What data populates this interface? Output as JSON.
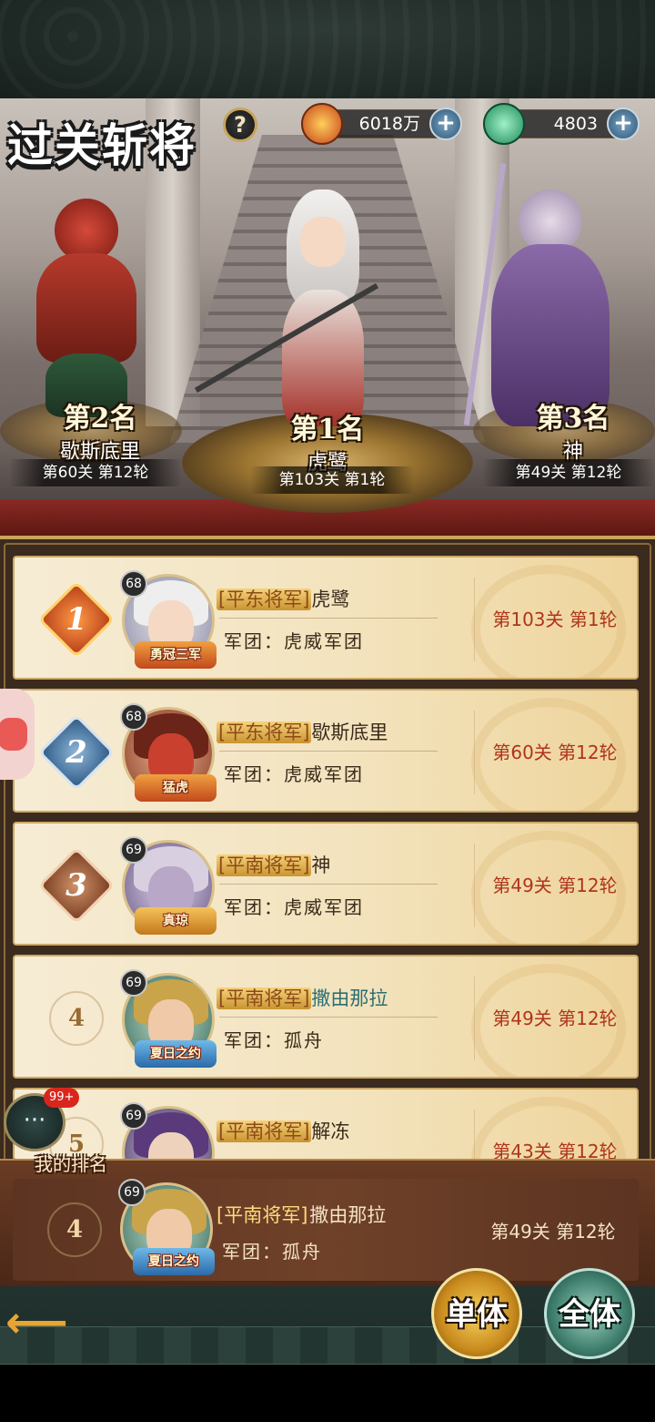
{
  "header": {
    "title": "过关斩将",
    "help_icon": "question-icon",
    "currencies": [
      {
        "icon": "gold-coin-icon",
        "value": "6018万",
        "add_icon": "plus-icon"
      },
      {
        "icon": "jade-icon",
        "value": "4803",
        "add_icon": "plus-icon"
      }
    ]
  },
  "podium": [
    {
      "rank_label": "第2名",
      "name": "歇斯底里",
      "progress": "第60关 第12轮"
    },
    {
      "rank_label": "第1名",
      "name": "虎鹭",
      "progress": "第103关 第1轮"
    },
    {
      "rank_label": "第3名",
      "name": "神",
      "progress": "第49关 第12轮"
    }
  ],
  "ranking": [
    {
      "rank": "1",
      "level": "68",
      "tag": "勇冠三军",
      "title": "[平东将军]",
      "name": "虎鹭",
      "legion": "军团：虎威军团",
      "progress": "第103关 第1轮"
    },
    {
      "rank": "2",
      "level": "68",
      "tag": "猛虎",
      "title": "[平东将军]",
      "name": "歇斯底里",
      "legion": "军团：虎威军团",
      "progress": "第60关 第12轮"
    },
    {
      "rank": "3",
      "level": "69",
      "tag": "真琼",
      "title": "[平南将军]",
      "name": "神",
      "legion": "军团：虎威军团",
      "progress": "第49关 第12轮"
    },
    {
      "rank": "4",
      "level": "69",
      "tag": "夏日之约",
      "title": "[平南将军]",
      "name": "撒由那拉",
      "legion": "军团：孤舟",
      "progress": "第49关 第12轮"
    },
    {
      "rank": "5",
      "level": "69",
      "tag": "",
      "title": "[平南将军]",
      "name": "解冻",
      "legion": "",
      "progress": "第43关 第12轮"
    }
  ],
  "chat": {
    "badge": "99+",
    "icon": "chat-bubble-icon"
  },
  "my_rank": {
    "label": "我的排名",
    "rank": "4",
    "level": "69",
    "tag": "夏日之约",
    "title": "[平南将军]",
    "name": "撒由那拉",
    "legion": "军团：孤舟",
    "progress": "第49关 第12轮"
  },
  "footer": {
    "back_icon": "back-arrow-icon",
    "single_label": "单体",
    "all_label": "全体"
  },
  "colors": {
    "progress_red": "#b0341a",
    "gold": "#c9a45a",
    "panel_cream": "#f3e3bd"
  }
}
